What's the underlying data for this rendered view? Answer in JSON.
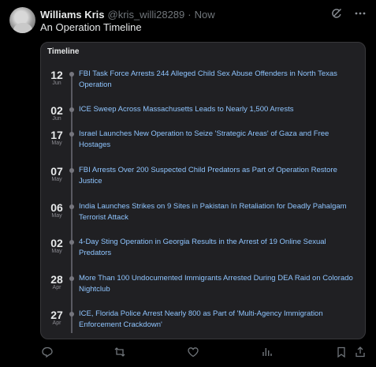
{
  "post": {
    "author_name": "Williams Kris",
    "author_handle": "@kris_willi28289",
    "separator": "·",
    "time": "Now",
    "text": "An Operation Timeline"
  },
  "card": {
    "title": "Timeline",
    "events": [
      {
        "day": "12",
        "month": "Jun",
        "title": "FBI Task Force Arrests 244 Alleged Child Sex Abuse Offenders in North Texas Operation"
      },
      {
        "day": "02",
        "month": "Jun",
        "title": "ICE Sweep Across Massachusetts Leads to Nearly 1,500 Arrests"
      },
      {
        "day": "17",
        "month": "May",
        "title": "Israel Launches New Operation to Seize 'Strategic Areas' of Gaza and Free Hostages"
      },
      {
        "day": "07",
        "month": "May",
        "title": "FBI Arrests Over 200 Suspected Child Predators as Part of Operation Restore Justice"
      },
      {
        "day": "06",
        "month": "May",
        "title": "India Launches Strikes on 9 Sites in Pakistan In Retaliation for Deadly Pahalgam Terrorist Attack"
      },
      {
        "day": "02",
        "month": "May",
        "title": "4-Day Sting Operation in Georgia Results in the Arrest of 19 Online Sexual Predators"
      },
      {
        "day": "28",
        "month": "Apr",
        "title": "More Than 100 Undocumented Immigrants Arrested During DEA Raid on Colorado Nightclub"
      },
      {
        "day": "27",
        "month": "Apr",
        "title": "ICE, Florida Police Arrest Nearly 800 as Part of 'Multi-Agency Immigration Enforcement Crackdown'"
      }
    ]
  },
  "icons": {
    "header": [
      "grok-icon",
      "more-icon"
    ],
    "actions": [
      "reply-icon",
      "repost-icon",
      "like-icon",
      "views-icon",
      "bookmark-icon",
      "share-icon"
    ]
  },
  "colors": {
    "background": "#000000",
    "card": "#202023",
    "link": "#8fc5ff",
    "muted": "#71767b"
  }
}
